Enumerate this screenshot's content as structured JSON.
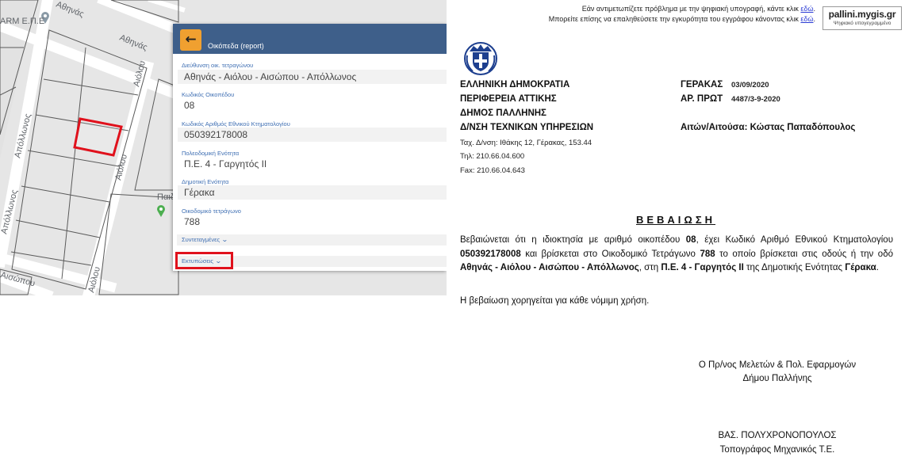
{
  "map": {
    "streets": {
      "athinas_top": "Αθηνάς",
      "athinas_mid": "Αθηνάς",
      "apollonos": "Απόλλωνος",
      "aiolou_upper": "Αιόλου",
      "aiolou_lower": "Αιόλου",
      "aisopou": "Αισώπου",
      "poi_partial": "ARM E.П.Е",
      "poi_side": "Παιδ",
      "apollonos_left": "Απόλλωνος"
    }
  },
  "panel": {
    "back_icon": "←",
    "title": "Οικόπεδα (report)",
    "fields": [
      {
        "label": "Διεύθυνση οικ. τετραγώνου",
        "value": "Αθηνάς - Αιόλου - Αισώπου - Απόλλωνος"
      },
      {
        "label": "Κωδικός Οικοπέδου",
        "value": "08"
      },
      {
        "label": "Κωδικός Αριθμός Εθνικού Κτηματολογίου",
        "value": "050392178008"
      },
      {
        "label": "Πολεοδομική Ενότητα",
        "value": "Π.Ε. 4 - Γαργητός ΙΙ"
      },
      {
        "label": "Δημοτική Ενότητα",
        "value": "Γέρακα"
      },
      {
        "label": "Οικοδομικό τετράγωνο",
        "value": "788"
      }
    ],
    "coordinates_label": "Συντεταγμένες",
    "printouts_label": "Εκτυπώσεις",
    "chevron": "⌄"
  },
  "document": {
    "notice_line1_text": "Εάν αντιμετωπίζετε πρόβλημα με την ψηφιακή υπογραφή, κάντε κλικ ",
    "notice_line1_link": "εδώ",
    "notice_line2_text": "Μπορείτε επίσης να επαληθεύσετε την εγκυρότητα του εγγράφου κάνοντας κλικ ",
    "notice_line2_link": "εδώ",
    "logo_main": "pallini.mygis.gr",
    "logo_sub": "Ψηφιακό υπογεγραμμένο",
    "org_lines": [
      "ΕΛΛΗΝΙΚΗ ΔΗΜΟΚΡΑΤΙΑ",
      "ΠΕΡΙΦΕΡΕΙΑ ΑΤΤΙΚΗΣ",
      "ΔΗΜΟΣ ΠΑΛΛΗΝΗΣ",
      "Δ/ΝΣΗ ΤΕΧΝΙΚΩΝ ΥΠΗΡΕΣΙΩΝ"
    ],
    "address": "Ταχ. Δ/νση: Ιθάκης 12, Γέρακας, 153.44",
    "phone": "Τηλ: 210.66.04.600",
    "fax": "Fax: 210.66.04.643",
    "place_label": "ΓΕΡΑΚΑΣ",
    "date": "03/09/2020",
    "prot_label": "ΑΡ. ΠΡΩΤ",
    "prot_value": "4487/3-9-2020",
    "applicant": "Αιτών/Αιτούσα: Κώστας Παπαδόπουλος",
    "cert_title": "ΒΕΒΑΙΩΣΗ",
    "body": {
      "p1": "Βεβαιώνεται ότι η ιδιοκτησία με αριθμό οικοπέδου ",
      "plot": "08",
      "p2": ", έχει Κωδικό Αριθμό Εθνικού Κτηματολογίου ",
      "kaek": "050392178008",
      "p3": " και βρίσκεται στο Οικοδομικό Τετράγωνο ",
      "block": "788",
      "p4": " το οποίο βρίσκεται στις οδούς ή την οδό ",
      "streets": "Αθηνάς - Αιόλου - Αισώπου - Απόλλωνος",
      "p5": ", στη ",
      "pe": "Π.Ε. 4 - Γαργητός ΙΙ",
      "p6": " της Δημοτικής Ενότητας ",
      "de": "Γέρακα",
      "p7": "."
    },
    "usage": "Η βεβαίωση χορηγείται για κάθε νόμιμη χρήση.",
    "signer_role_1": "Ο Πρ/νος Μελετών & Πολ. Εφαρμογών",
    "signer_role_2": "Δήμου Παλλήνης",
    "signer_name": "ΒΑΣ.  ΠΟΛΥΧΡΟΝΟΠΟΥΛΟΣ",
    "signer_title": "Τοπογράφος Μηχανικός Τ.Ε."
  },
  "colors": {
    "panel_header": "#3e5f8a",
    "back_button": "#f0a030",
    "field_label": "#3f6fb3",
    "highlight": "#e0111c",
    "link": "#2a3bd4"
  }
}
